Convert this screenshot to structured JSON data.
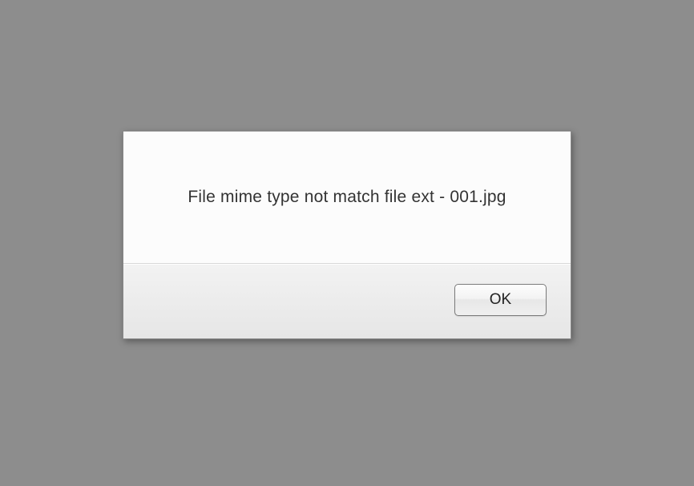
{
  "dialog": {
    "message": "File mime type not match file ext - 001.jpg",
    "ok_label": "OK"
  }
}
